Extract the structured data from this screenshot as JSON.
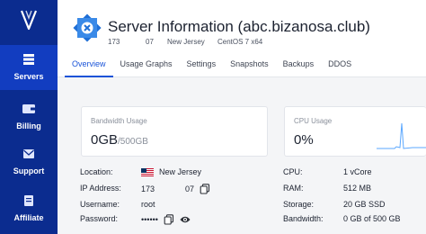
{
  "sidebar": {
    "items": [
      {
        "label": "Servers",
        "icon": "servers-icon",
        "active": true
      },
      {
        "label": "Billing",
        "icon": "wallet-icon"
      },
      {
        "label": "Support",
        "icon": "mail-icon"
      },
      {
        "label": "Affiliate",
        "icon": "affiliate-icon"
      }
    ]
  },
  "header": {
    "title": "Server Information (abc.bizanosa.club)",
    "ip_part_a": "173",
    "ip_part_b": "07",
    "location": "New Jersey",
    "os": "CentOS 7 x64"
  },
  "tabs": [
    {
      "label": "Overview",
      "active": true
    },
    {
      "label": "Usage Graphs"
    },
    {
      "label": "Settings"
    },
    {
      "label": "Snapshots"
    },
    {
      "label": "Backups"
    },
    {
      "label": "DDOS"
    }
  ],
  "cards": {
    "bandwidth": {
      "label": "Bandwidth Usage",
      "value": "0GB",
      "total": "/500GB"
    },
    "cpu": {
      "label": "CPU Usage",
      "value": "0%"
    }
  },
  "info_left": {
    "location_label": "Location:",
    "location_value": "New Jersey",
    "ip_label": "IP Address:",
    "ip_part_a": "173",
    "ip_part_b": "07",
    "username_label": "Username:",
    "username_value": "root",
    "password_label": "Password:",
    "password_value": "••••••"
  },
  "info_right": {
    "cpu_label": "CPU:",
    "cpu_value": "1 vCore",
    "ram_label": "RAM:",
    "ram_value": "512 MB",
    "storage_label": "Storage:",
    "storage_value": "20 GB SSD",
    "bandwidth_label": "Bandwidth:",
    "bandwidth_value": "0 GB of 500 GB"
  },
  "colors": {
    "sidebar_bg": "#0b2c8f",
    "accent": "#1953d8"
  }
}
